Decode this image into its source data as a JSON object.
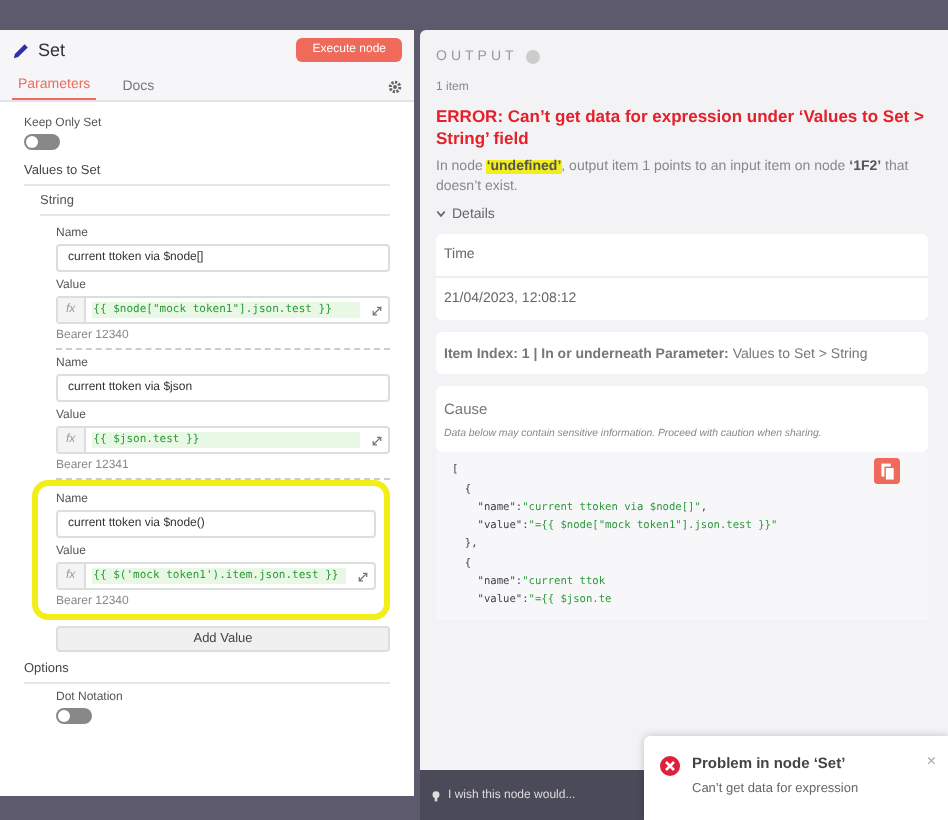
{
  "node": {
    "title": "Set",
    "execute_button": "Execute node"
  },
  "tabs": [
    {
      "label": "Parameters",
      "selected": true
    },
    {
      "label": "Docs",
      "selected": false
    }
  ],
  "keep_only_set": {
    "label": "Keep Only Set",
    "on": false
  },
  "values_to_set": {
    "label": "Values to Set",
    "group": "String",
    "add_button": "Add Value",
    "entries": [
      {
        "name_label": "Name",
        "name": "current ttoken via $node[]",
        "value_label": "Value",
        "fx": "fx",
        "value": "{{ $node[\"mock token1\"].json.test }}",
        "result": "Bearer 12340",
        "highlighted": false
      },
      {
        "name_label": "Name",
        "name": "current ttoken via $json",
        "value_label": "Value",
        "fx": "fx",
        "value": "{{ $json.test }}",
        "result": "Bearer 12341",
        "highlighted": false
      },
      {
        "name_label": "Name",
        "name": "current ttoken via $node()",
        "value_label": "Value",
        "fx": "fx",
        "value": "{{  $('mock token1').item.json.test }}",
        "result": "Bearer 12340",
        "highlighted": true
      }
    ]
  },
  "options": {
    "label": "Options",
    "dot_notation": {
      "label": "Dot Notation",
      "on": false
    }
  },
  "feedback": "I wish this node would...",
  "output": {
    "heading": "OUTPUT",
    "count": "1 item",
    "error_title": "ERROR: Can’t get data for expression under ‘Values to Set > String’ field",
    "description": [
      {
        "text": "In node ",
        "bold": false,
        "highlighted": false
      },
      {
        "text": "‘undefined’",
        "bold": true,
        "highlighted": true
      },
      {
        "text": ", output item 1 points to an input item on node ",
        "bold": false,
        "highlighted": false
      },
      {
        "text": "‘1F2’",
        "bold": true,
        "highlighted": false
      },
      {
        "text": " that doesn’t exist.",
        "bold": false,
        "highlighted": false
      }
    ],
    "details": "Details",
    "time_label": "Time",
    "time": "21/04/2023, 12:08:12",
    "item_index": "**Item Index: 1 | In or underneath Parameter:** Values to Set > String",
    "cause_label": "Cause",
    "cause_note": "Data below may contain sensitive information. Proceed with caution when sharing.",
    "code": [
      {
        "key": "["
      },
      {
        "key": "  {"
      },
      {
        "key": "    \"name\":",
        "value": "\"current ttoken via $node[]\"",
        "tail": ","
      },
      {
        "key": "    \"value\":",
        "value": "\"={{ $node[\"mock token1\"].json.test }}\""
      },
      {
        "key": "  },"
      },
      {
        "key": "  {"
      },
      {
        "key": "    \"name\":",
        "value": "\"current ttok"
      },
      {
        "key": "    \"value\":",
        "value": "\"={{ $json.te"
      }
    ]
  },
  "toast": {
    "title": "Problem in node ‘Set’",
    "message": "Can’t get data for expression",
    "close": "×"
  }
}
